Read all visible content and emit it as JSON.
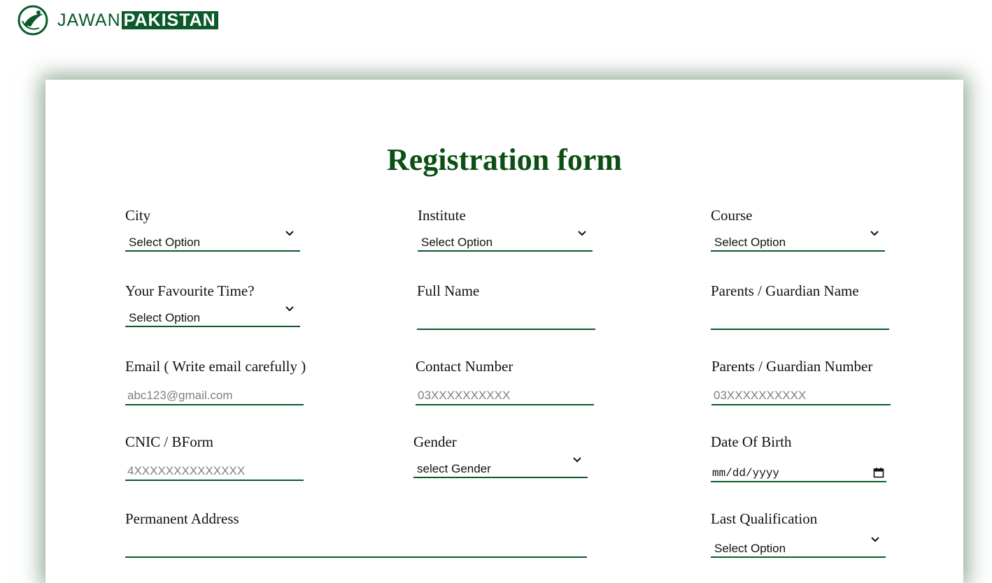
{
  "brand": {
    "name_part1": "JAWAN",
    "name_part2": "PAKISTAN",
    "color": "#0b5a2a"
  },
  "form": {
    "title": "Registration form",
    "city": {
      "label": "City",
      "selected": "Select Option"
    },
    "institute": {
      "label": "Institute",
      "selected": "Select Option"
    },
    "course": {
      "label": "Course",
      "selected": "Select Option"
    },
    "favourite_time": {
      "label": "Your Favourite Time?",
      "selected": "Select Option"
    },
    "full_name": {
      "label": "Full Name",
      "value": ""
    },
    "guardian_name": {
      "label": "Parents / Guardian Name",
      "value": ""
    },
    "email": {
      "label": "Email ( Write email carefully )",
      "placeholder": "abc123@gmail.com"
    },
    "contact_number": {
      "label": "Contact Number",
      "placeholder": "03XXXXXXXXXX"
    },
    "guardian_number": {
      "label": "Parents / Guardian Number",
      "placeholder": "03XXXXXXXXXX"
    },
    "cnic": {
      "label": "CNIC / BForm",
      "placeholder": "4XXXXXXXXXXXXXX"
    },
    "gender": {
      "label": "Gender",
      "selected": "select Gender"
    },
    "dob": {
      "label": "Date Of Birth",
      "placeholder": "mm/dd/yyyy"
    },
    "address": {
      "label": "Permanent Address",
      "value": ""
    },
    "last_qualification": {
      "label": "Last Qualification",
      "selected": "Select Option"
    }
  },
  "icons": {
    "dropdown": "chevron-down-icon",
    "calendar": "calendar-icon",
    "logo": "logo-icon"
  }
}
